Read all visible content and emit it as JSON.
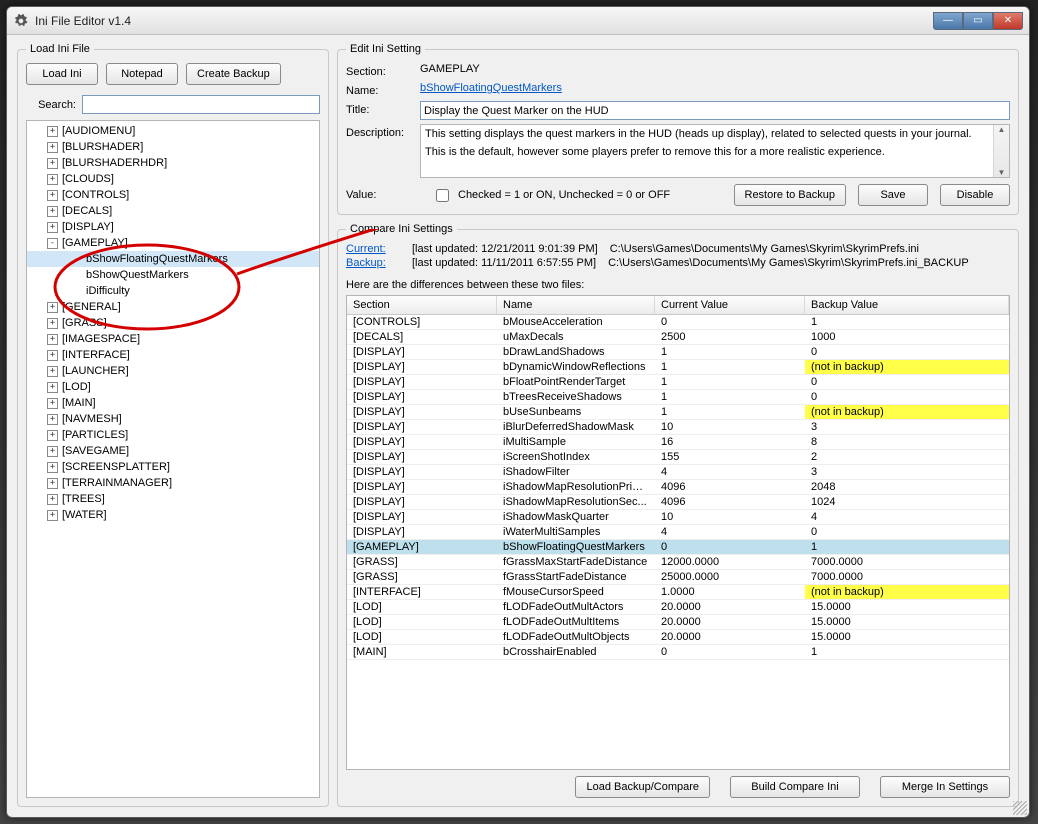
{
  "window": {
    "title": "Ini File Editor v1.4"
  },
  "left": {
    "legend": "Load Ini File",
    "buttons": {
      "load": "Load Ini",
      "notepad": "Notepad",
      "backup": "Create Backup"
    },
    "searchLabel": "Search:",
    "tree": [
      {
        "d": 1,
        "e": "+",
        "t": "[AUDIOMENU]"
      },
      {
        "d": 1,
        "e": "+",
        "t": "[BLURSHADER]"
      },
      {
        "d": 1,
        "e": "+",
        "t": "[BLURSHADERHDR]"
      },
      {
        "d": 1,
        "e": "+",
        "t": "[CLOUDS]"
      },
      {
        "d": 1,
        "e": "+",
        "t": "[CONTROLS]"
      },
      {
        "d": 1,
        "e": "+",
        "t": "[DECALS]"
      },
      {
        "d": 1,
        "e": "+",
        "t": "[DISPLAY]"
      },
      {
        "d": 1,
        "e": "-",
        "t": "[GAMEPLAY]"
      },
      {
        "d": 2,
        "e": " ",
        "t": "bShowFloatingQuestMarkers",
        "sel": true
      },
      {
        "d": 2,
        "e": " ",
        "t": "bShowQuestMarkers"
      },
      {
        "d": 2,
        "e": " ",
        "t": "iDifficulty"
      },
      {
        "d": 1,
        "e": "+",
        "t": "[GENERAL]"
      },
      {
        "d": 1,
        "e": "+",
        "t": "[GRASS]"
      },
      {
        "d": 1,
        "e": "+",
        "t": "[IMAGESPACE]"
      },
      {
        "d": 1,
        "e": "+",
        "t": "[INTERFACE]"
      },
      {
        "d": 1,
        "e": "+",
        "t": "[LAUNCHER]"
      },
      {
        "d": 1,
        "e": "+",
        "t": "[LOD]"
      },
      {
        "d": 1,
        "e": "+",
        "t": "[MAIN]"
      },
      {
        "d": 1,
        "e": "+",
        "t": "[NAVMESH]"
      },
      {
        "d": 1,
        "e": "+",
        "t": "[PARTICLES]"
      },
      {
        "d": 1,
        "e": "+",
        "t": "[SAVEGAME]"
      },
      {
        "d": 1,
        "e": "+",
        "t": "[SCREENSPLATTER]"
      },
      {
        "d": 1,
        "e": "+",
        "t": "[TERRAINMANAGER]"
      },
      {
        "d": 1,
        "e": "+",
        "t": "[TREES]"
      },
      {
        "d": 1,
        "e": "+",
        "t": "[WATER]"
      }
    ]
  },
  "edit": {
    "legend": "Edit Ini Setting",
    "labels": {
      "section": "Section:",
      "name": "Name:",
      "title": "Title:",
      "description": "Description:",
      "value": "Value:"
    },
    "section": "GAMEPLAY",
    "name": "bShowFloatingQuestMarkers",
    "title": "Display the Quest Marker on the HUD",
    "description1": "This setting displays the quest markers in the HUD (heads up display), related to selected quests in your journal.",
    "description2": "This is the default, however some players prefer to remove this for a more realistic experience.",
    "valueLabel": "Checked = 1 or ON, Unchecked = 0 or OFF",
    "buttons": {
      "restore": "Restore to Backup",
      "save": "Save",
      "disable": "Disable"
    }
  },
  "compare": {
    "legend": "Compare Ini Settings",
    "currentLabel": "Current:",
    "backupLabel": "Backup:",
    "currentInfo": "[last updated: 12/21/2011 9:01:39 PM]",
    "backupInfo": "[last updated: 11/11/2011 6:57:55 PM]",
    "currentPath": "C:\\Users\\Games\\Documents\\My Games\\Skyrim\\SkyrimPrefs.ini",
    "backupPath": "C:\\Users\\Games\\Documents\\My Games\\Skyrim\\SkyrimPrefs.ini_BACKUP",
    "diffLabel": "Here are the differences between these two files:",
    "headers": {
      "section": "Section",
      "name": "Name",
      "current": "Current Value",
      "backup": "Backup Value"
    },
    "rows": [
      {
        "s": "[CONTROLS]",
        "n": "bMouseAcceleration",
        "c": "0",
        "b": "1"
      },
      {
        "s": "[DECALS]",
        "n": "uMaxDecals",
        "c": "2500",
        "b": "1000"
      },
      {
        "s": "[DISPLAY]",
        "n": "bDrawLandShadows",
        "c": "1",
        "b": "0"
      },
      {
        "s": "[DISPLAY]",
        "n": "bDynamicWindowReflections",
        "c": "1",
        "b": "(not in backup)",
        "nb": true
      },
      {
        "s": "[DISPLAY]",
        "n": "bFloatPointRenderTarget",
        "c": "1",
        "b": "0"
      },
      {
        "s": "[DISPLAY]",
        "n": "bTreesReceiveShadows",
        "c": "1",
        "b": "0"
      },
      {
        "s": "[DISPLAY]",
        "n": "bUseSunbeams",
        "c": "1",
        "b": "(not in backup)",
        "nb": true
      },
      {
        "s": "[DISPLAY]",
        "n": "iBlurDeferredShadowMask",
        "c": "10",
        "b": "3"
      },
      {
        "s": "[DISPLAY]",
        "n": "iMultiSample",
        "c": "16",
        "b": "8"
      },
      {
        "s": "[DISPLAY]",
        "n": "iScreenShotIndex",
        "c": "155",
        "b": "2"
      },
      {
        "s": "[DISPLAY]",
        "n": "iShadowFilter",
        "c": "4",
        "b": "3"
      },
      {
        "s": "[DISPLAY]",
        "n": "iShadowMapResolutionPrim...",
        "c": "4096",
        "b": "2048"
      },
      {
        "s": "[DISPLAY]",
        "n": "iShadowMapResolutionSec...",
        "c": "4096",
        "b": "1024"
      },
      {
        "s": "[DISPLAY]",
        "n": "iShadowMaskQuarter",
        "c": "10",
        "b": "4"
      },
      {
        "s": "[DISPLAY]",
        "n": "iWaterMultiSamples",
        "c": "4",
        "b": "0"
      },
      {
        "s": "[GAMEPLAY]",
        "n": "bShowFloatingQuestMarkers",
        "c": "0",
        "b": "1",
        "sel": true
      },
      {
        "s": "[GRASS]",
        "n": "fGrassMaxStartFadeDistance",
        "c": "12000.0000",
        "b": "7000.0000"
      },
      {
        "s": "[GRASS]",
        "n": "fGrassStartFadeDistance",
        "c": "25000.0000",
        "b": "7000.0000"
      },
      {
        "s": "[INTERFACE]",
        "n": "fMouseCursorSpeed",
        "c": "1.0000",
        "b": "(not in backup)",
        "nb": true
      },
      {
        "s": "[LOD]",
        "n": "fLODFadeOutMultActors",
        "c": "20.0000",
        "b": "15.0000"
      },
      {
        "s": "[LOD]",
        "n": "fLODFadeOutMultItems",
        "c": "20.0000",
        "b": "15.0000"
      },
      {
        "s": "[LOD]",
        "n": "fLODFadeOutMultObjects",
        "c": "20.0000",
        "b": "15.0000"
      },
      {
        "s": "[MAIN]",
        "n": "bCrosshairEnabled",
        "c": "0",
        "b": "1"
      }
    ],
    "bottom": {
      "load": "Load Backup/Compare",
      "build": "Build Compare Ini",
      "merge": "Merge In Settings"
    }
  }
}
